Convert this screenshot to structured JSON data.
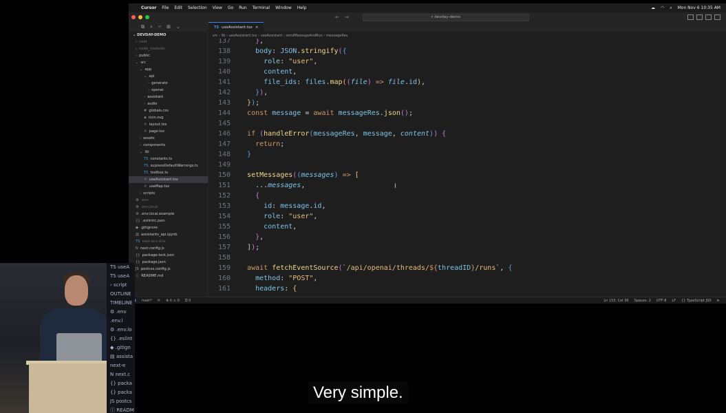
{
  "menubar": {
    "app_name": "Cursor",
    "items": [
      "File",
      "Edit",
      "Selection",
      "View",
      "Go",
      "Run",
      "Terminal",
      "Window",
      "Help"
    ],
    "clock": "Mon Nov 6  10:35 AM"
  },
  "titlebar": {
    "search": "devday-demo"
  },
  "tab": {
    "lang": "TS",
    "label": "useAssistant.tsx",
    "close": "×"
  },
  "breadcrumb": [
    "src",
    "lib",
    "useAssistant.tsx",
    "useAssistant",
    "sendMessageAndRun",
    "messageRes"
  ],
  "sidebar": {
    "root": "DEVDAY-DEMO",
    "items": [
      {
        "label": "next",
        "indent": 1,
        "icon": "›",
        "dim": true
      },
      {
        "label": "node_modules",
        "indent": 1,
        "icon": "›",
        "dim": true
      },
      {
        "label": "public",
        "indent": 1,
        "icon": "›"
      },
      {
        "label": "src",
        "indent": 1,
        "icon": "⌄"
      },
      {
        "label": "app",
        "indent": 2,
        "icon": "⌄"
      },
      {
        "label": "api",
        "indent": 3,
        "icon": "⌄"
      },
      {
        "label": "generate",
        "indent": 4,
        "icon": "›"
      },
      {
        "label": "openai",
        "indent": 4,
        "icon": "›"
      },
      {
        "label": "assistant",
        "indent": 3,
        "icon": "›"
      },
      {
        "label": "audio",
        "indent": 3,
        "icon": "›"
      },
      {
        "label": "globals.css",
        "indent": 3,
        "icon": "#"
      },
      {
        "label": "icon.svg",
        "indent": 3,
        "icon": "◈"
      },
      {
        "label": "layout.tsx",
        "indent": 3,
        "icon": "⚛"
      },
      {
        "label": "page.tsx",
        "indent": 3,
        "icon": "⚛"
      },
      {
        "label": "assets",
        "indent": 2,
        "icon": "›"
      },
      {
        "label": "components",
        "indent": 2,
        "icon": "›"
      },
      {
        "label": "lib",
        "indent": 2,
        "icon": "⌄"
      },
      {
        "label": "constants.ts",
        "indent": 3,
        "icon": "TS"
      },
      {
        "label": "supressDefaultWarnings.ts",
        "indent": 3,
        "icon": "TS"
      },
      {
        "label": "toolbox.ts",
        "indent": 3,
        "icon": "TS"
      },
      {
        "label": "useAssistant.tsx",
        "indent": 3,
        "icon": "⚛",
        "selected": true
      },
      {
        "label": "useMap.tsx",
        "indent": 3,
        "icon": "⚛"
      },
      {
        "label": "scripts",
        "indent": 2,
        "icon": "›"
      },
      {
        "label": ".env",
        "indent": 1,
        "icon": "⚙",
        "dim": true
      },
      {
        "label": ".env.local",
        "indent": 1,
        "icon": "⚙",
        "dim": true
      },
      {
        "label": ".env.local.example",
        "indent": 1,
        "icon": "⚙"
      },
      {
        "label": ".eslintrc.json",
        "indent": 1,
        "icon": "{}"
      },
      {
        "label": ".gitignore",
        "indent": 1,
        "icon": "◆"
      },
      {
        "label": "assistants_api.ipynb",
        "indent": 1,
        "icon": "▤"
      },
      {
        "label": "next-env.d.ts",
        "indent": 1,
        "icon": "TS",
        "dim": true
      },
      {
        "label": "next.config.js",
        "indent": 1,
        "icon": "N"
      },
      {
        "label": "package-lock.json",
        "indent": 1,
        "icon": "{}"
      },
      {
        "label": "package.json",
        "indent": 1,
        "icon": "{}"
      },
      {
        "label": "postcss.config.js",
        "indent": 1,
        "icon": "JS"
      },
      {
        "label": "README.md",
        "indent": 1,
        "icon": "ⓘ"
      }
    ]
  },
  "code": {
    "lines": [
      {
        "n": "137",
        "html": "    <span class='br2'>}</span>,"
      },
      {
        "n": "138",
        "html": "    <span class='v'>body</span>: <span class='v'>JSON</span>.<span class='fn'>stringify</span><span class='br2'>(</span><span class='br3'>{</span>"
      },
      {
        "n": "139",
        "html": "      <span class='v'>role</span>: <span class='s'>\"user\"</span>,"
      },
      {
        "n": "140",
        "html": "      <span class='v'>content</span>,"
      },
      {
        "n": "141",
        "html": "      <span class='v'>file_ids</span>: <span class='v'>files</span>.<span class='fn'>map</span><span class='br1'>(</span><span class='br2'>(</span><span class='v it'>file</span><span class='br2'>)</span> <span class='k'>=></span> <span class='v it'>file</span>.<span class='v'>id</span><span class='br1'>)</span>,"
      },
      {
        "n": "142",
        "html": "    <span class='br3'>}</span><span class='br2'>)</span>,"
      },
      {
        "n": "143",
        "html": "  <span class='br1'>}</span><span class='br3'>)</span>;"
      },
      {
        "n": "144",
        "html": "  <span class='k'>const</span> <span class='v'>message</span> = <span class='k'>await</span> <span class='v'>messageRes</span>.<span class='fn'>json</span><span class='br2'>()</span>;"
      },
      {
        "n": "145",
        "html": ""
      },
      {
        "n": "146",
        "html": "  <span class='k'>if</span> <span class='br2'>(</span><span class='fn'>handleError</span><span class='br3'>(</span><span class='v'>messageRes</span>, <span class='v'>message</span>, <span class='v it'>content</span><span class='br3'>)</span><span class='br2'>)</span> <span class='br2'>{</span>"
      },
      {
        "n": "147",
        "html": "    <span class='k'>return</span>;"
      },
      {
        "n": "148",
        "html": "  <span class='br3'>}</span>"
      },
      {
        "n": "149",
        "html": ""
      },
      {
        "n": "150",
        "html": "  <span class='fn'>setMessages</span><span class='br2'>(</span><span class='br3'>(</span><span class='v it'>messages</span><span class='br3'>)</span> <span class='k'>=></span> <span class='br1'>[</span>"
      },
      {
        "n": "151",
        "html": "    ...<span class='v it'>messages</span>,"
      },
      {
        "n": "152",
        "html": "    <span class='br2'>{</span>"
      },
      {
        "n": "153",
        "html": "      <span class='v'>id</span>: <span class='v'>message</span>.<span class='v'>id</span>,"
      },
      {
        "n": "154",
        "html": "      <span class='v'>role</span>: <span class='s'>\"user\"</span>,"
      },
      {
        "n": "155",
        "html": "      <span class='v'>content</span>,"
      },
      {
        "n": "156",
        "html": "    <span class='br2'>}</span>,"
      },
      {
        "n": "157",
        "html": "  <span class='br1'>]</span><span class='br2'>)</span>;"
      },
      {
        "n": "158",
        "html": ""
      },
      {
        "n": "159",
        "html": "  <span class='k'>await</span> <span class='fn'>fetchEventSource</span><span class='br2'>(</span><span class='s'>`/api/openai/threads/</span><span class='k'>${</span><span class='v'>threadID</span><span class='k'>}</span><span class='s'>/runs`</span>, <span class='br3'>{</span>"
      },
      {
        "n": "160",
        "html": "    <span class='v'>method</span>: <span class='s'>\"POST\"</span>,"
      },
      {
        "n": "161",
        "html": "    <span class='v'>headers</span>: <span class='br1'>{</span>"
      }
    ]
  },
  "statusbar": {
    "branch": "main*",
    "sync": "⟳",
    "problems": "⊗ 0 ⚠ 0",
    "ports": "⚿ 0",
    "position": "Ln 153, Col 36",
    "spaces": "Spaces: 2",
    "encoding": "UTF-8",
    "eol": "LF",
    "language": "{} TypeScript JSX"
  },
  "webcam_panel": {
    "items": [
      "TS  useA",
      "TS  useA",
      "›  script",
      "OUTLINE",
      "TIMELINE",
      "⚙  .env",
      "   .env.l",
      "⚙  .env.lo",
      "{} .eslint",
      "◆  .gitign",
      "▤  assista",
      "   next-e",
      "N  next.c",
      "{} packa",
      "{} packa",
      "JS postcs",
      "ⓘ  READM",
      "OUTLINE"
    ]
  },
  "caption": "Very simple."
}
